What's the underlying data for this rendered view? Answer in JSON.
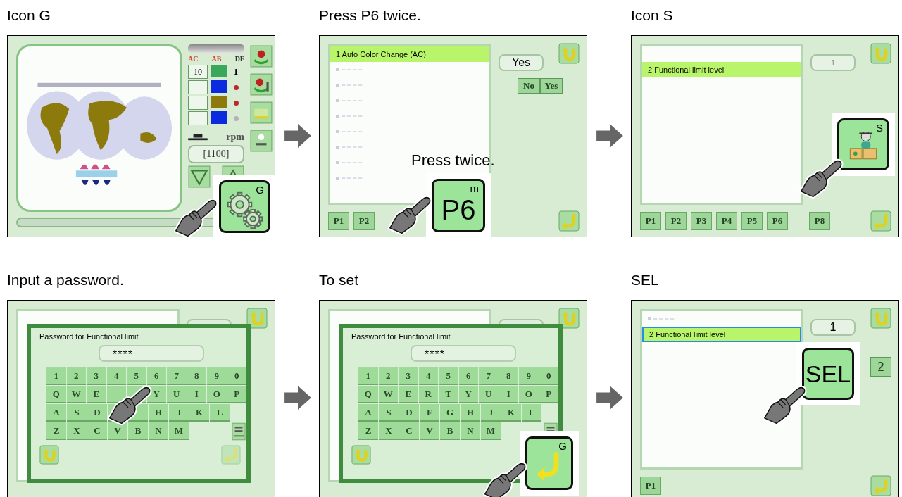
{
  "steps": [
    {
      "heading": "Icon G",
      "kind": "home",
      "labels": [
        {
          "text": "AC",
          "color": "#d8402e"
        },
        {
          "text": "AB",
          "color": "#d8402e"
        },
        {
          "text": "DF",
          "color": "#333333"
        }
      ],
      "counter": "10",
      "needle": "1",
      "threads": [
        {
          "color": "#3aa85a"
        },
        {
          "color": "#0a2ae0"
        },
        {
          "color": "#8c7a0c"
        },
        {
          "color": "#0a2ae0"
        }
      ],
      "status_dots": [
        {
          "color": "#b8282c"
        },
        {
          "color": "#b8282c"
        },
        {
          "color": "#b4b4b4"
        }
      ],
      "speed_unit": "rpm",
      "speed": "[1100]",
      "callout": {
        "kind": "gears",
        "letter": "G"
      }
    },
    {
      "heading": "Press P6 twice.",
      "kind": "list",
      "rows": [
        {
          "kind": "item",
          "text": "1 Auto Color Change (AC)",
          "selected": true
        },
        {
          "kind": "faded",
          "selected": false
        },
        {
          "kind": "faded",
          "selected": false
        },
        {
          "kind": "faded",
          "selected": false
        },
        {
          "kind": "faded",
          "selected": false
        },
        {
          "kind": "faded",
          "selected": false
        },
        {
          "kind": "faded",
          "selected": false
        },
        {
          "kind": "faded",
          "selected": false
        },
        {
          "kind": "faded",
          "selected": false
        }
      ],
      "value": "Yes",
      "value_faint": false,
      "choices": [
        "No",
        "Yes"
      ],
      "tab_groups": [
        [
          "P1",
          "P2"
        ]
      ],
      "note": "Press twice.",
      "callout": {
        "kind": "text",
        "label": "P6",
        "letter": "m"
      }
    },
    {
      "heading": "Icon S",
      "kind": "list",
      "rows": [
        {
          "kind": "item",
          "text": "2 Functional limit level",
          "selected": true
        }
      ],
      "value": "1",
      "value_faint": true,
      "tab_groups": [
        [
          "P1",
          "P2",
          "P3",
          "P4",
          "P5",
          "P6"
        ],
        [
          "P8"
        ]
      ],
      "callout": {
        "kind": "person",
        "letter": "S"
      }
    },
    {
      "heading": "Input a password.",
      "kind": "keyboard",
      "dialog_title": "Password for Functional limit",
      "password": "****",
      "key_rows": [
        [
          {
            "label": "1"
          },
          {
            "label": "2"
          },
          {
            "label": "3"
          },
          {
            "label": "4"
          },
          {
            "label": "5"
          },
          {
            "label": "6"
          },
          {
            "label": "7"
          },
          {
            "label": "8"
          },
          {
            "label": "9"
          },
          {
            "label": "0"
          }
        ],
        [
          {
            "label": "Q"
          },
          {
            "label": "W"
          },
          {
            "label": "E"
          },
          {
            "covered": true
          },
          {
            "covered": true
          },
          {
            "label": "Y"
          },
          {
            "label": "U"
          },
          {
            "label": "I"
          },
          {
            "label": "O"
          },
          {
            "label": "P"
          }
        ],
        [
          {
            "label": "A"
          },
          {
            "label": "S"
          },
          {
            "label": "D"
          },
          {
            "covered": true
          },
          {
            "covered": true
          },
          {
            "label": "H"
          },
          {
            "label": "J"
          },
          {
            "label": "K"
          },
          {
            "label": "L"
          }
        ],
        [
          {
            "label": "Z"
          },
          {
            "label": "X"
          },
          {
            "label": "C"
          },
          {
            "label": "V"
          },
          {
            "label": "B"
          },
          {
            "label": "N"
          },
          {
            "label": "M"
          }
        ]
      ]
    },
    {
      "heading": "To set",
      "kind": "keyboard",
      "dialog_title": "Password for Functional limit",
      "password": "****",
      "key_rows": [
        [
          {
            "label": "1"
          },
          {
            "label": "2"
          },
          {
            "label": "3"
          },
          {
            "label": "4"
          },
          {
            "label": "5"
          },
          {
            "label": "6"
          },
          {
            "label": "7"
          },
          {
            "label": "8"
          },
          {
            "label": "9"
          },
          {
            "label": "0"
          }
        ],
        [
          {
            "label": "Q"
          },
          {
            "label": "W"
          },
          {
            "label": "E"
          },
          {
            "label": "R"
          },
          {
            "label": "T"
          },
          {
            "label": "Y"
          },
          {
            "label": "U"
          },
          {
            "label": "I"
          },
          {
            "label": "O"
          },
          {
            "label": "P"
          }
        ],
        [
          {
            "label": "A"
          },
          {
            "label": "S"
          },
          {
            "label": "D"
          },
          {
            "label": "F"
          },
          {
            "label": "G"
          },
          {
            "label": "H"
          },
          {
            "label": "J"
          },
          {
            "label": "K"
          },
          {
            "label": "L"
          }
        ],
        [
          {
            "label": "Z"
          },
          {
            "label": "X"
          },
          {
            "label": "C"
          },
          {
            "label": "V"
          },
          {
            "label": "B"
          },
          {
            "label": "N"
          },
          {
            "label": "M"
          }
        ]
      ],
      "callout": {
        "kind": "enter",
        "letter": "G"
      }
    },
    {
      "heading": "SEL",
      "kind": "list",
      "rows": [
        {
          "kind": "faded",
          "selected": false
        },
        {
          "kind": "item",
          "text": "2 Functional limit level",
          "selected": true,
          "focused": true
        }
      ],
      "value": "1",
      "value_faint": false,
      "side_button": "2",
      "tab_groups": [
        [
          "P1"
        ]
      ],
      "callout": {
        "kind": "text",
        "label": "SEL"
      }
    }
  ]
}
